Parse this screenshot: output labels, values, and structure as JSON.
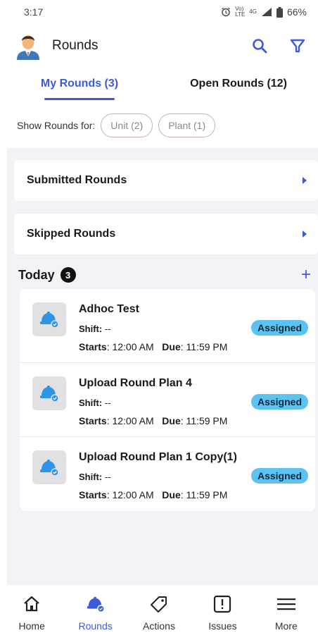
{
  "status_bar": {
    "time": "3:17",
    "network_top": "Vo)",
    "network_bottom": "LTE",
    "signal_text": "4G",
    "battery": "66%"
  },
  "header": {
    "title": "Rounds",
    "search_icon": "search-icon",
    "filter_icon": "filter-icon"
  },
  "tabs": [
    {
      "label": "My Rounds (3)",
      "active": true
    },
    {
      "label": "Open Rounds (12)",
      "active": false
    }
  ],
  "filters": {
    "label": "Show Rounds for:",
    "chips": [
      "Unit (2)",
      "Plant (1)"
    ]
  },
  "sections": [
    {
      "label": "Submitted Rounds"
    },
    {
      "label": "Skipped Rounds"
    }
  ],
  "today": {
    "label": "Today",
    "count": "3",
    "add_label": "+"
  },
  "rounds": [
    {
      "name": "Adhoc Test",
      "shift_label": "Shift:",
      "shift_value": "--",
      "starts_label": "Starts",
      "starts_value": ": 12:00 AM",
      "due_label": "Due",
      "due_value": ": 11:59 PM",
      "status": "Assigned"
    },
    {
      "name": "Upload Round Plan 4",
      "shift_label": "Shift:",
      "shift_value": "--",
      "starts_label": "Starts",
      "starts_value": ": 12:00 AM",
      "due_label": "Due",
      "due_value": ": 11:59 PM",
      "status": "Assigned"
    },
    {
      "name": "Upload Round Plan 1 Copy(1)",
      "shift_label": "Shift:",
      "shift_value": "--",
      "starts_label": "Starts",
      "starts_value": ": 12:00 AM",
      "due_label": "Due",
      "due_value": ": 11:59 PM",
      "status": "Assigned"
    }
  ],
  "nav": [
    {
      "label": "Home",
      "icon": "home-icon"
    },
    {
      "label": "Rounds",
      "icon": "helmet-icon"
    },
    {
      "label": "Actions",
      "icon": "tag-icon"
    },
    {
      "label": "Issues",
      "icon": "alert-icon"
    },
    {
      "label": "More",
      "icon": "menu-icon"
    }
  ],
  "colors": {
    "accent": "#3d5bd9",
    "status_assigned": "#5cc2f2",
    "helmet": "#2c95e8",
    "content_bg": "#f3f2f6"
  }
}
